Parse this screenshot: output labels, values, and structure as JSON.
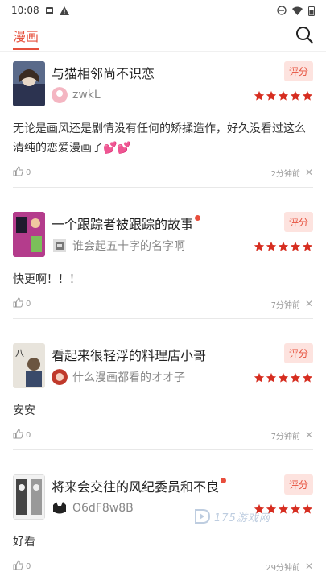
{
  "status_bar": {
    "time": "10:08"
  },
  "header": {
    "tab_label": "漫画",
    "search_icon": "search-icon"
  },
  "comments": [
    {
      "title": "与猫相邻尚不识恋",
      "has_dot": false,
      "badge": "评分",
      "username": "zwkL",
      "rating": 5,
      "text": "无论是画风还是剧情没有任何的矫揉造作，好久没看过这么清纯的恋爱漫画了💕💕",
      "likes": "0",
      "time": "2分钟前",
      "colors": {
        "cover": "#5a6a8a",
        "avatar": "#f4b6c2"
      }
    },
    {
      "title": "一个跟踪者被跟踪的故事",
      "has_dot": true,
      "badge": "评分",
      "username": "谁会起五十字的名字啊",
      "rating": 5,
      "text": "快更啊！！！",
      "likes": "0",
      "time": "7分钟前",
      "colors": {
        "cover": "#b43c8c",
        "avatar": "#777777"
      }
    },
    {
      "title": "看起来很轻浮的料理店小哥",
      "has_dot": false,
      "badge": "评分",
      "username": "什么漫画都看的オオ子",
      "rating": 5,
      "text": "安安",
      "likes": "0",
      "time": "7分钟前",
      "colors": {
        "cover": "#e8e4dc",
        "avatar": "#c0392b"
      }
    },
    {
      "title": "将来会交往的风纪委员和不良",
      "has_dot": true,
      "badge": "评分",
      "username": "O6dF8w8B",
      "rating": 5,
      "text": "好看",
      "likes": "0",
      "time": "29分钟前",
      "colors": {
        "cover": "#f2f2f2",
        "avatar": "#222222"
      }
    }
  ],
  "watermark": {
    "text": "175游戏网"
  },
  "colors": {
    "accent": "#e6503c",
    "star": "#d62d20",
    "badge_bg": "#fde3df"
  }
}
